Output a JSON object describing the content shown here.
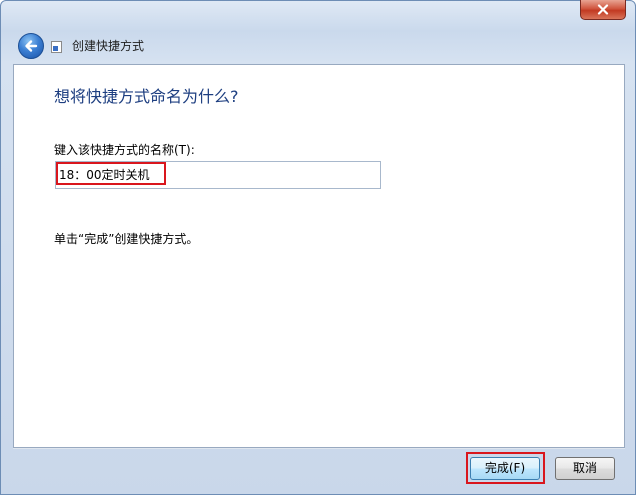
{
  "window": {
    "title": "创建快捷方式",
    "close_icon": "close-icon",
    "back_icon": "back-arrow-icon",
    "accent_color": "#1d3e80",
    "highlight_color": "#d9161d"
  },
  "main": {
    "heading": "想将快捷方式命名为什么?",
    "name_label": "键入该快捷方式的名称(T):",
    "name_value": "18：00定时关机",
    "hint": "单击“完成”创建快捷方式。"
  },
  "footer": {
    "finish_label": "完成(F)",
    "cancel_label": "取消"
  }
}
